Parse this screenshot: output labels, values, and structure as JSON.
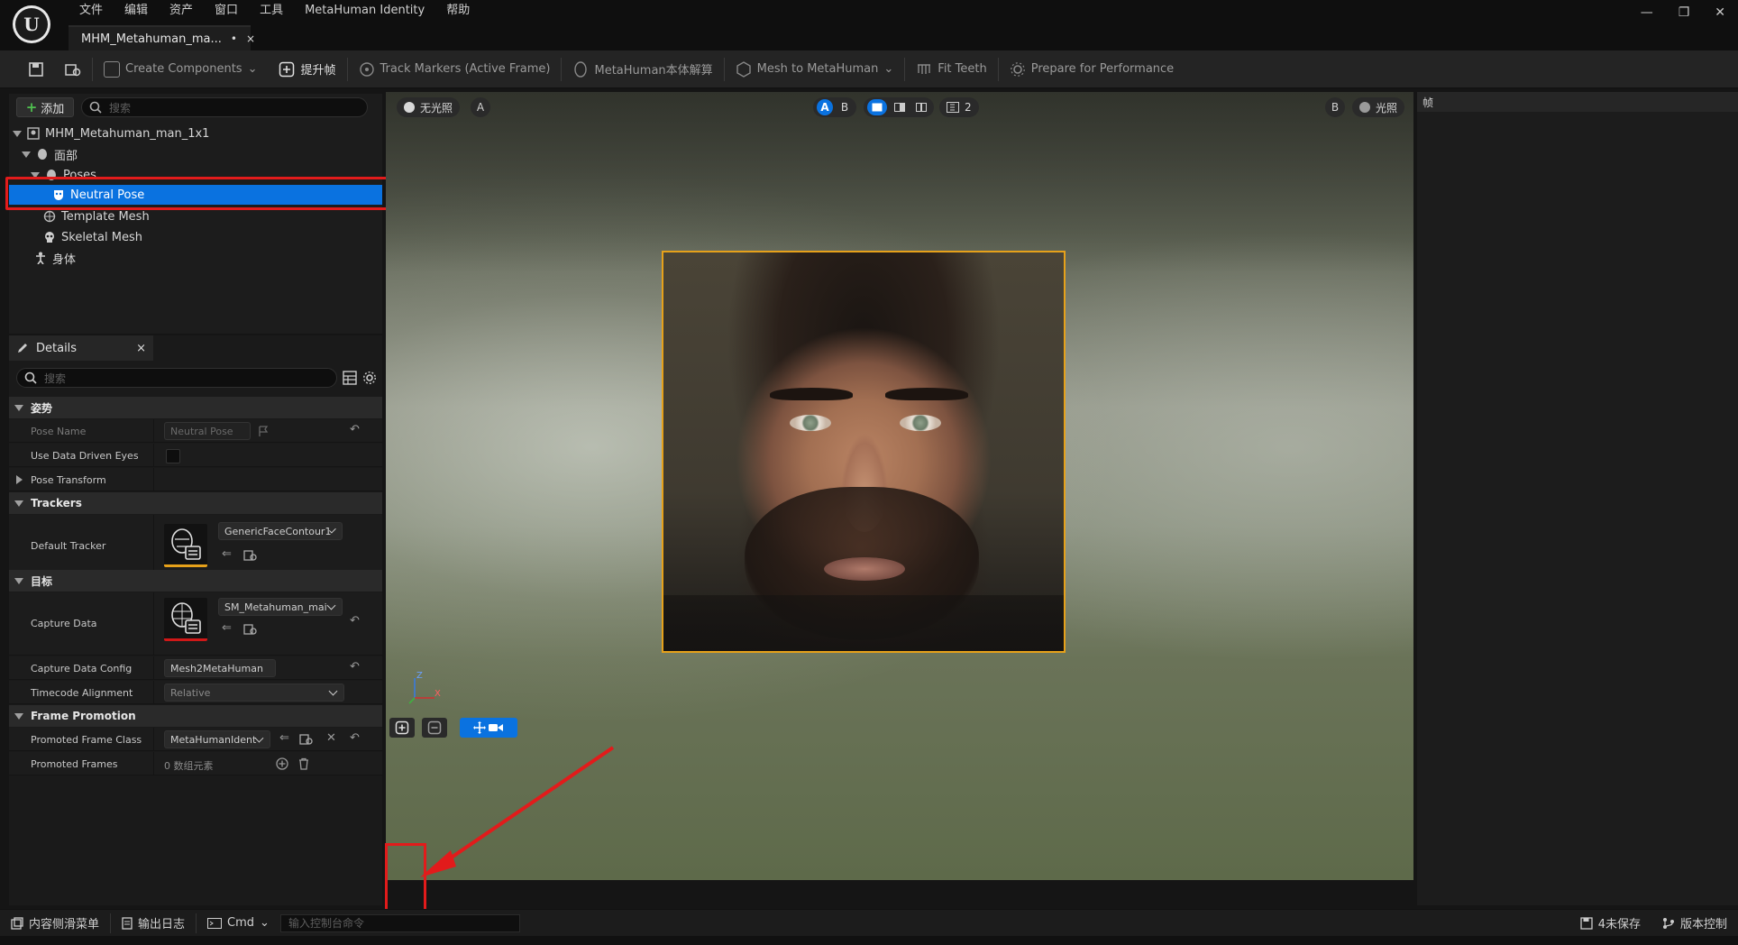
{
  "menu": [
    "文件",
    "编辑",
    "资产",
    "窗口",
    "工具",
    "MetaHuman Identity",
    "帮助"
  ],
  "doc_tab": {
    "title": "MHM_Metahuman_ma...",
    "modified": "•",
    "close": "×"
  },
  "window_controls": {
    "minimize": "—",
    "restore": "❐",
    "close": "✕"
  },
  "toolbar": {
    "create_components": "Create Components",
    "promote_frame": "提升帧",
    "track_markers": "Track Markers (Active Frame)",
    "solve": "MetaHuman本体解算",
    "mesh_to_metahuman": "Mesh to MetaHuman",
    "fit_teeth": "Fit Teeth",
    "prepare_performance": "Prepare for Performance"
  },
  "outliner": {
    "add_label": "添加",
    "search_placeholder": "搜索",
    "items": [
      {
        "label": "MHM_Metahuman_man_1x1"
      },
      {
        "label": "面部"
      },
      {
        "label": "Poses"
      },
      {
        "label": "Neutral Pose"
      },
      {
        "label": "Template Mesh"
      },
      {
        "label": "Skeletal Mesh"
      },
      {
        "label": "身体"
      }
    ]
  },
  "details": {
    "tab_label": "Details",
    "close": "×",
    "search_placeholder": "搜索",
    "sections": {
      "pose": "姿势",
      "trackers": "Trackers",
      "target": "目标",
      "frame_promotion": "Frame Promotion"
    },
    "pose_name": {
      "label": "Pose Name",
      "value": "Neutral Pose"
    },
    "use_data_driven_eyes": {
      "label": "Use Data Driven Eyes",
      "checked": false
    },
    "pose_transform": {
      "label": "Pose Transform"
    },
    "default_tracker": {
      "label": "Default Tracker",
      "value": "GenericFaceContour1"
    },
    "capture_data": {
      "label": "Capture Data",
      "value": "SM_Metahuman_mai"
    },
    "capture_data_config": {
      "label": "Capture Data Config",
      "value": "Mesh2MetaHuman"
    },
    "timecode_alignment": {
      "label": "Timecode Alignment",
      "value": "Relative"
    },
    "promoted_frame_class": {
      "label": "Promoted Frame Class",
      "value": "MetaHumanIdent"
    },
    "promoted_frames": {
      "label": "Promoted Frames",
      "value": "0 数组元素"
    }
  },
  "viewport": {
    "lighting_left": "无光照",
    "view_a": "A",
    "ab_a": "A",
    "ab_b": "B",
    "layers_count": "2",
    "view_b": "B",
    "lighting_right": "光照",
    "gizmo_z": "Z",
    "gizmo_x": "X"
  },
  "right_panel": {
    "title": "帧"
  },
  "statusbar": {
    "content_drawer": "内容侧滑菜单",
    "output_log": "输出日志",
    "cmd": "Cmd",
    "cmd_placeholder": "输入控制台命令",
    "unsaved": "4未保存",
    "source_control": "版本控制"
  },
  "colors": {
    "accent": "#0a72e0",
    "highlight": "#e21b1b",
    "frame": "#e6a11a"
  }
}
